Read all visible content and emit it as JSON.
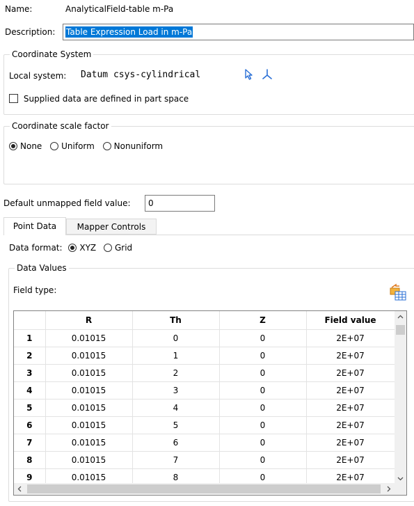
{
  "name": {
    "label": "Name:",
    "value": "AnalyticalField-table m-Pa"
  },
  "description": {
    "label": "Description:",
    "value": "Table Expression Load in m-Pa"
  },
  "coordinate_system": {
    "title": "Coordinate System",
    "local_system_label": "Local system:",
    "local_system_value": "Datum csys-cylindrical",
    "supplied_label": "Supplied data are defined in part space",
    "supplied_checked": false
  },
  "scale_factor": {
    "title": "Coordinate scale factor",
    "options": [
      "None",
      "Uniform",
      "Nonuniform"
    ],
    "selected": "None"
  },
  "default_unmapped": {
    "label": "Default unmapped field value:",
    "value": "0"
  },
  "tabs": [
    {
      "label": "Point Data",
      "active": true
    },
    {
      "label": "Mapper Controls",
      "active": false
    }
  ],
  "data_format": {
    "label": "Data format:",
    "options": [
      "XYZ",
      "Grid"
    ],
    "selected": "XYZ"
  },
  "data_values": {
    "title": "Data Values",
    "field_type_label": "Field type:",
    "columns": [
      "R",
      "Th",
      "Z",
      "Field value"
    ],
    "rows": [
      {
        "num": "1",
        "cells": [
          "0.01015",
          "0",
          "0",
          "2E+07"
        ]
      },
      {
        "num": "2",
        "cells": [
          "0.01015",
          "1",
          "0",
          "2E+07"
        ]
      },
      {
        "num": "3",
        "cells": [
          "0.01015",
          "2",
          "0",
          "2E+07"
        ]
      },
      {
        "num": "4",
        "cells": [
          "0.01015",
          "3",
          "0",
          "2E+07"
        ]
      },
      {
        "num": "5",
        "cells": [
          "0.01015",
          "4",
          "0",
          "2E+07"
        ]
      },
      {
        "num": "6",
        "cells": [
          "0.01015",
          "5",
          "0",
          "2E+07"
        ]
      },
      {
        "num": "7",
        "cells": [
          "0.01015",
          "6",
          "0",
          "2E+07"
        ]
      },
      {
        "num": "8",
        "cells": [
          "0.01015",
          "7",
          "0",
          "2E+07"
        ]
      },
      {
        "num": "9",
        "cells": [
          "0.01015",
          "8",
          "0",
          "2E+07"
        ]
      }
    ]
  },
  "colors": {
    "selection": "#0078d7",
    "csys_icon": "#2a6fd6",
    "table_icon_orange": "#e07b20"
  }
}
